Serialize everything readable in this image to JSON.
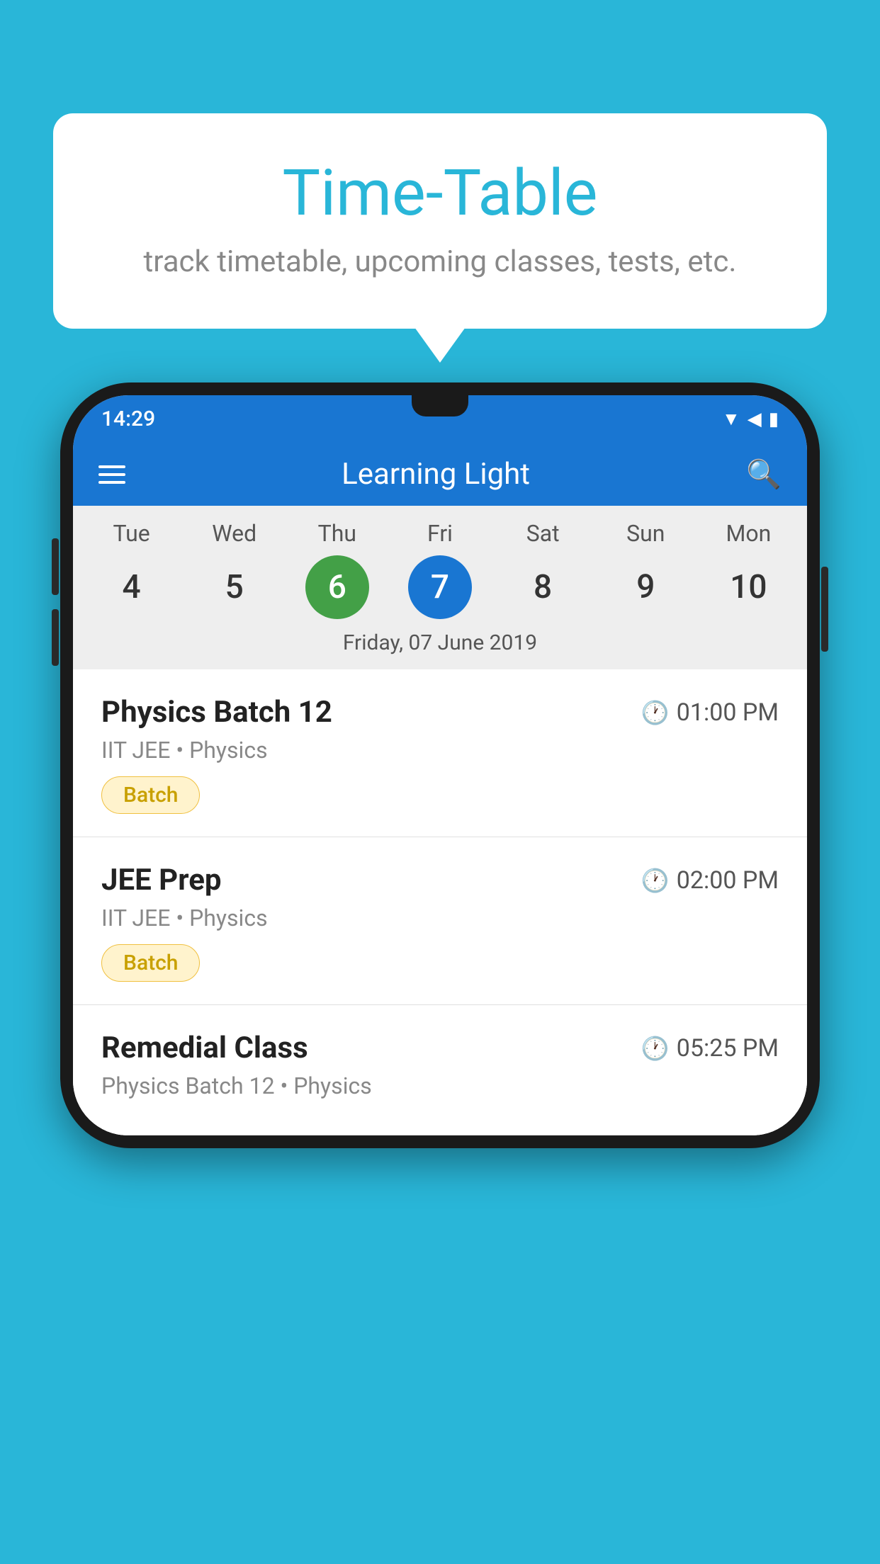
{
  "background_color": "#29b6d8",
  "bubble": {
    "title": "Time-Table",
    "subtitle": "track timetable, upcoming classes, tests, etc."
  },
  "app": {
    "status_time": "14:29",
    "app_name": "Learning Light"
  },
  "calendar": {
    "days": [
      {
        "name": "Tue",
        "num": "4",
        "state": "normal"
      },
      {
        "name": "Wed",
        "num": "5",
        "state": "normal"
      },
      {
        "name": "Thu",
        "num": "6",
        "state": "today"
      },
      {
        "name": "Fri",
        "num": "7",
        "state": "selected"
      },
      {
        "name": "Sat",
        "num": "8",
        "state": "normal"
      },
      {
        "name": "Sun",
        "num": "9",
        "state": "normal"
      },
      {
        "name": "Mon",
        "num": "10",
        "state": "normal"
      }
    ],
    "selected_date_label": "Friday, 07 June 2019"
  },
  "schedule": [
    {
      "title": "Physics Batch 12",
      "time": "01:00 PM",
      "meta": "IIT JEE • Physics",
      "badge": "Batch"
    },
    {
      "title": "JEE Prep",
      "time": "02:00 PM",
      "meta": "IIT JEE • Physics",
      "badge": "Batch"
    },
    {
      "title": "Remedial Class",
      "time": "05:25 PM",
      "meta": "Physics Batch 12 • Physics",
      "badge": ""
    }
  ]
}
